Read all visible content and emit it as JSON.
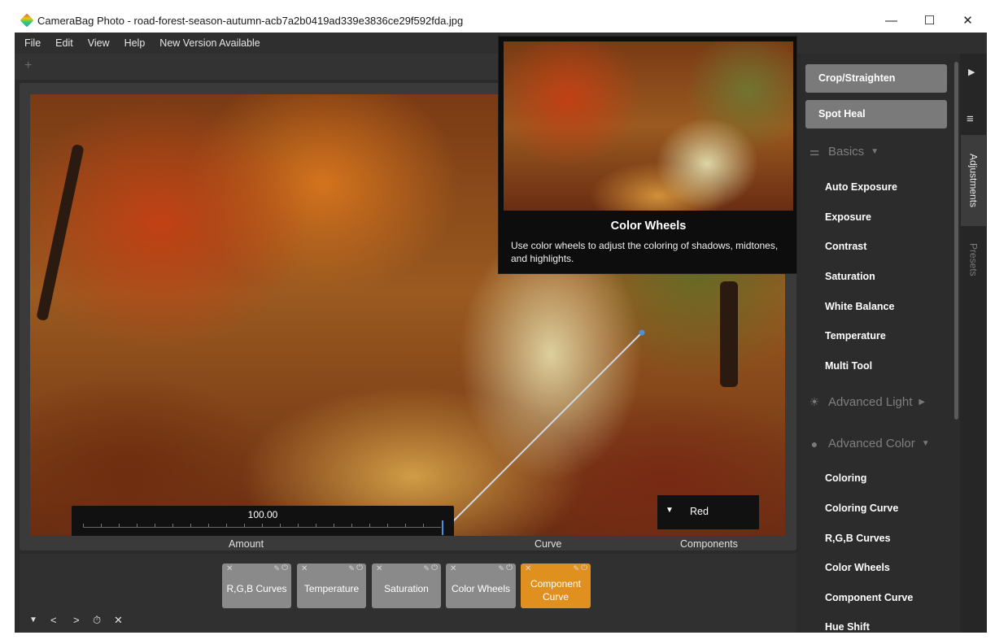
{
  "window": {
    "title": "CameraBag Photo - road-forest-season-autumn-acb7a2b0419ad339e3836ce29f592fda.jpg",
    "controls": {
      "minimize": "—",
      "maximize": "☐",
      "close": "✕"
    }
  },
  "menu": [
    "File",
    "Edit",
    "View",
    "Help",
    "New Version Available"
  ],
  "tabstrip": {
    "add_label": "+"
  },
  "canvas": {
    "amount": {
      "value": "100.00",
      "caption": "Amount",
      "level": 1.0
    },
    "curve": {
      "caption": "Curve"
    },
    "components": {
      "value": "Red",
      "caption": "Components"
    }
  },
  "tooltip": {
    "title": "Color Wheels",
    "description": "Use color wheels to adjust the coloring of shadows, midtones, and highlights."
  },
  "layers": [
    {
      "label": "R,G,B Curves",
      "active": false
    },
    {
      "label": "Temperature",
      "active": false
    },
    {
      "label": "Saturation",
      "active": false
    },
    {
      "label": "Color Wheels",
      "active": false
    },
    {
      "label": "Component Curve",
      "active": true
    }
  ],
  "layer_icons": {
    "remove": "✕",
    "pin": "📌",
    "power": "⏻"
  },
  "bottom_controls": {
    "collapse": "▼",
    "prev": "<",
    "next": ">",
    "history": "⏱",
    "close": "✕"
  },
  "right_panel": {
    "tools": [
      "Crop/Straighten",
      "Spot Heal"
    ],
    "sections": [
      {
        "title": "Basics",
        "icon": "sliders-icon",
        "glyph": "⚌",
        "expanded": true,
        "items": [
          "Auto Exposure",
          "Exposure",
          "Contrast",
          "Saturation",
          "White Balance",
          "Temperature",
          "Multi Tool"
        ]
      },
      {
        "title": "Advanced Light",
        "icon": "sun-icon",
        "glyph": "☀",
        "expanded": false,
        "items": []
      },
      {
        "title": "Advanced Color",
        "icon": "color-circles-icon",
        "glyph": "●",
        "expanded": true,
        "items": [
          "Coloring",
          "Coloring Curve",
          "R,G,B Curves",
          "Color Wheels",
          "Component Curve",
          "Hue Shift"
        ]
      }
    ]
  },
  "side_tabs": {
    "active": "Adjustments",
    "inactive": "Presets",
    "play": "▶",
    "menu": "≡"
  },
  "colors": {
    "accent": "#e0901e",
    "handle": "#4a8fe0",
    "chip": "#8a8a8a"
  }
}
